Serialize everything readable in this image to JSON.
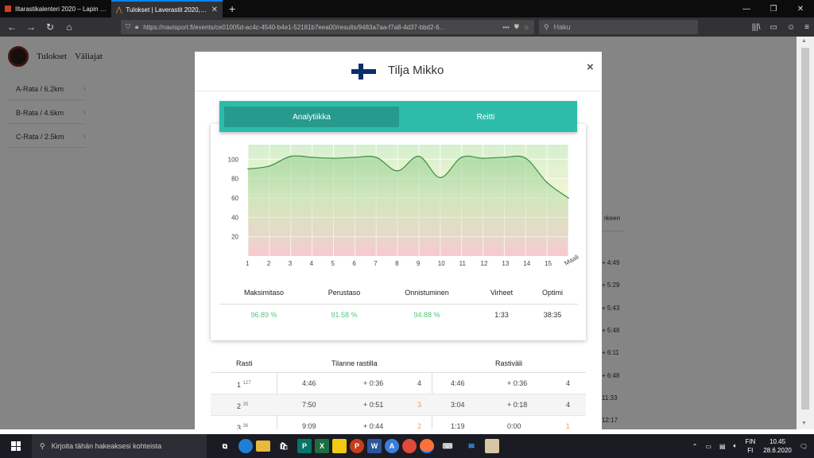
{
  "browser": {
    "tabs": [
      {
        "title": "Iltarastikalenteri 2020 – Lapin V..."
      },
      {
        "title": "Tulokset | Laverastit 2020, Kelun..."
      }
    ],
    "new_tab": "+",
    "url": "https://navisport.fi/events/ce01005d-ac4c-4540-b4e1-52181b7eea00/results/9483a7aa-f7a8-4d37-bbd2-6...",
    "url_actions": "•••",
    "search_placeholder": "Haku",
    "window_controls": [
      "—",
      "❐",
      "✕"
    ],
    "toolbar_icons": [
      "|||\\",
      "▭",
      "☺",
      "≡"
    ]
  },
  "site": {
    "nav": [
      "Tulokset",
      "Väliajat"
    ],
    "courses": [
      "A-Rata / 6.2km",
      "B-Rata / 4.6km",
      "C-Rata / 2.5km"
    ],
    "bg_header_partial": "rkeen",
    "bg_values": [
      "+ 4:49",
      "+ 5:29",
      "+ 5:43",
      "+ 5:48",
      "+ 6:11",
      "+ 6:48",
      "11:33",
      "12:17"
    ]
  },
  "modal": {
    "athlete_name": "Tilja Mikko",
    "close": "×",
    "tabs": [
      "Analytiikka",
      "Reitti"
    ],
    "stats_headers": [
      "Maksimitaso",
      "Perustaso",
      "Onnistuminen",
      "Virheet",
      "Optimi"
    ],
    "stats_values": [
      "96.89 %",
      "91.58 %",
      "94.88 %",
      "1:33",
      "38:35"
    ],
    "table": {
      "headers": [
        "Rasti",
        "Tilanne rastilla",
        "Rastiväli"
      ],
      "rows": [
        {
          "rasti": "1",
          "code": "127",
          "time": "4:46",
          "diff": "+ 0:36",
          "rank": "4",
          "leg_time": "4:46",
          "leg_diff": "+ 0:36",
          "leg_rank": "4"
        },
        {
          "rasti": "2",
          "code": "35",
          "time": "7:50",
          "diff": "+ 0:51",
          "rank": "3",
          "leg_time": "3:04",
          "leg_diff": "+ 0:18",
          "leg_rank": "4"
        },
        {
          "rasti": "3",
          "code": "36",
          "time": "9:09",
          "diff": "+ 0:44",
          "rank": "2",
          "leg_time": "1:19",
          "leg_diff": "0:00",
          "leg_rank": "1"
        }
      ]
    }
  },
  "chart_data": {
    "type": "area",
    "x": [
      "1",
      "2",
      "3",
      "4",
      "5",
      "6",
      "7",
      "8",
      "9",
      "10",
      "11",
      "12",
      "13",
      "14",
      "15",
      "Maali"
    ],
    "series": [
      {
        "values": [
          90,
          93,
          103,
          102,
          101,
          102,
          102,
          88,
          103,
          81,
          102,
          101,
          102,
          101,
          76,
          60
        ]
      }
    ],
    "ylim": [
      0,
      115
    ],
    "yticks": [
      "20",
      "40",
      "60",
      "80",
      "100"
    ],
    "grid": true,
    "background_bands": "gradient green (top) to red (bottom)",
    "line_color": "#3a8f3e"
  },
  "taskbar": {
    "search_placeholder": "Kirjoita tähän hakeaksesi kohteista",
    "lang_top": "FIN",
    "lang_bottom": "FI",
    "time": "10.45",
    "date": "28.6.2020"
  }
}
